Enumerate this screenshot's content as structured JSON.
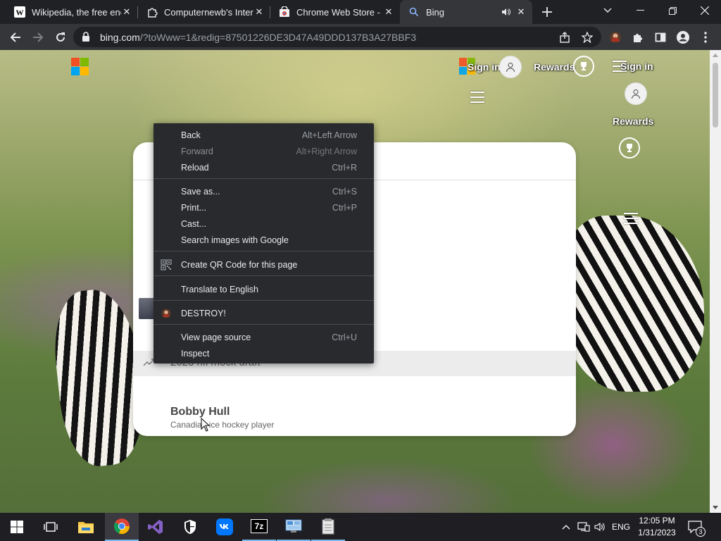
{
  "tabs": [
    {
      "title": "Wikipedia, the free encyclopedia",
      "favicon": "wikipedia-icon"
    },
    {
      "title": "Computernewb's Internet",
      "favicon": "puzzle-icon"
    },
    {
      "title": "Chrome Web Store - Extensions",
      "favicon": "chrome-webstore-icon"
    },
    {
      "title": "Bing",
      "favicon": "search-icon",
      "active": true
    }
  ],
  "omnibox": {
    "host": "bing.com",
    "path": "/?toWww=1&redig=87501226DE3D47A49DDD137B3A27BBF3"
  },
  "bing": {
    "sign_in": "Sign in",
    "rewards": "Rewards",
    "sign_in_2": "Sign in",
    "rewards_2": "Rewards"
  },
  "search": {
    "suggestion": "2023 nfl mock draft",
    "entity_title": "Bobby Hull",
    "entity_subtitle": "Canadian ice hockey player"
  },
  "context_menu": {
    "back": {
      "label": "Back",
      "shortcut": "Alt+Left Arrow"
    },
    "forward": {
      "label": "Forward",
      "shortcut": "Alt+Right Arrow"
    },
    "reload": {
      "label": "Reload",
      "shortcut": "Ctrl+R"
    },
    "save_as": {
      "label": "Save as...",
      "shortcut": "Ctrl+S"
    },
    "print": {
      "label": "Print...",
      "shortcut": "Ctrl+P"
    },
    "cast": {
      "label": "Cast..."
    },
    "search_images": {
      "label": "Search images with Google"
    },
    "qr": {
      "label": "Create QR Code for this page"
    },
    "translate": {
      "label": "Translate to English"
    },
    "destroy": {
      "label": "DESTROY!"
    },
    "view_source": {
      "label": "View page source",
      "shortcut": "Ctrl+U"
    },
    "inspect": {
      "label": "Inspect"
    }
  },
  "taskbar": {
    "language": "ENG",
    "time": "12:05 PM",
    "date": "1/31/2023",
    "notifications": "3",
    "app_7zip": "7z"
  },
  "colors": {
    "ms_red": "#f25022",
    "ms_green": "#7fba00",
    "ms_blue": "#00a4ef",
    "ms_yellow": "#ffb900"
  }
}
